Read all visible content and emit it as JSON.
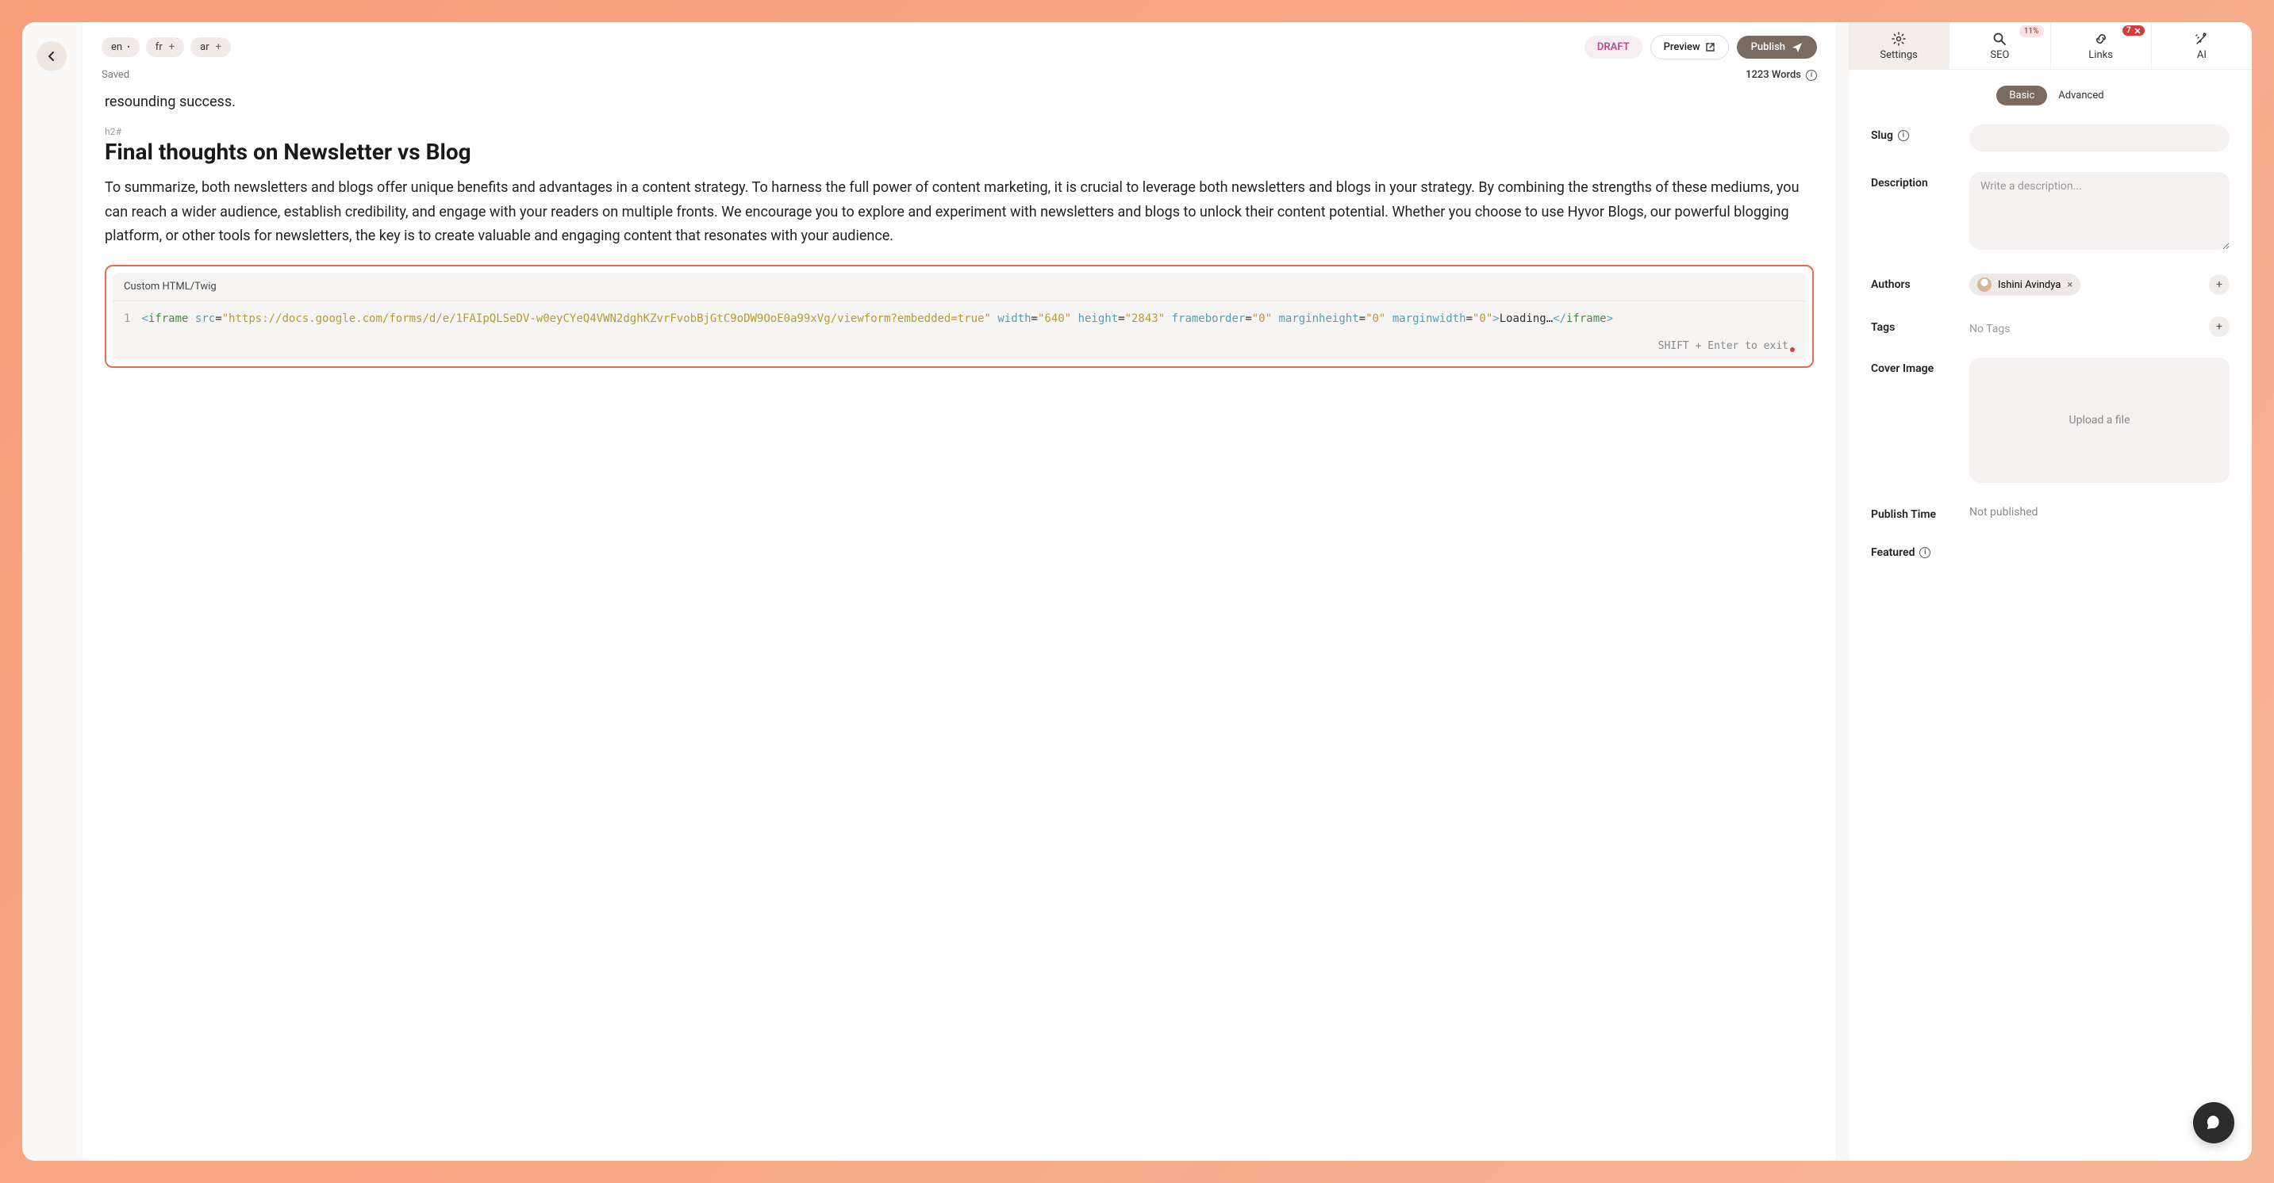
{
  "toolbar": {
    "langs": [
      {
        "code": "en",
        "active": true
      },
      {
        "code": "fr",
        "active": false
      },
      {
        "code": "ar",
        "active": false
      }
    ],
    "draft_label": "DRAFT",
    "preview_label": "Preview",
    "publish_label": "Publish",
    "saved_label": "Saved",
    "word_count_label": "1223 Words"
  },
  "content": {
    "trail": "resounding success.",
    "block_type": "h2#",
    "heading": "Final thoughts on Newsletter vs Blog",
    "paragraph": "To summarize, both newsletters and blogs offer unique benefits and advantages in a content strategy. To harness the full power of content marketing, it is crucial to leverage both newsletters and blogs in your strategy. By combining the strengths of these mediums, you can reach a wider audience, establish credibility, and engage with your readers on multiple fronts. We encourage you to explore and experiment with newsletters and blogs to unlock their content potential. Whether you choose to use Hyvor Blogs, our powerful blogging platform, or other tools for newsletters, the key is to create valuable and engaging content that resonates with your audience."
  },
  "code_block": {
    "title": "Custom HTML/Twig",
    "line_number": "1",
    "src_url": "\"https://docs.google.com/forms/d/e/1FAIpQLSeDV-w0eyCYeQ4VWN2dghKZvrFvobBjGtC9oDW9OoE0a99xVg/viewform?embedded=true\"",
    "width_val": "\"640\"",
    "height_val": "\"2843\"",
    "frameborder_val": "\"0\"",
    "marginheight_val": "\"0\"",
    "marginwidth_val": "\"0\"",
    "loading_text": "Loading…",
    "shortcut_hint": "SHIFT + Enter to exit"
  },
  "sidebar": {
    "tabs": {
      "settings": "Settings",
      "seo": "SEO",
      "seo_pct": "11%",
      "links": "Links",
      "links_count": "7",
      "ai": "AI"
    },
    "subtabs": {
      "basic": "Basic",
      "advanced": "Advanced"
    },
    "labels": {
      "slug": "Slug",
      "description": "Description",
      "authors": "Authors",
      "tags": "Tags",
      "cover": "Cover Image",
      "publish_time": "Publish Time",
      "featured": "Featured"
    },
    "desc_placeholder": "Write a description...",
    "author_name": "Ishini Avindya",
    "no_tags": "No Tags",
    "upload_text": "Upload a file",
    "publish_value": "Not published"
  }
}
